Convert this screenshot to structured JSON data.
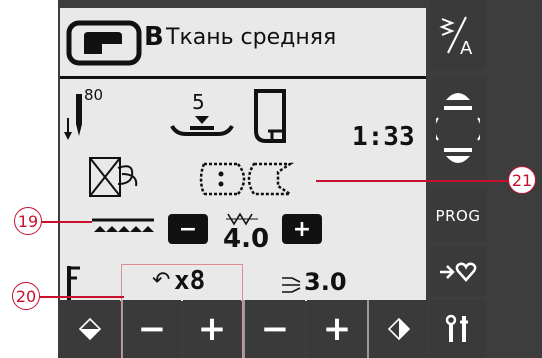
{
  "header": {
    "fabric_label": "Ткань средняя",
    "stitch_group": "B"
  },
  "needle": {
    "size": "80"
  },
  "presser_foot": {
    "pressure": "5"
  },
  "stitch": {
    "number": "1:33"
  },
  "width": {
    "value": "4.0",
    "minus_label": "−",
    "plus_label": "+"
  },
  "repeat": {
    "prefix": "↶",
    "value": "x8"
  },
  "length": {
    "value": "3.0"
  },
  "right_buttons": {
    "alpha_label": "A",
    "prog_label": "PROG"
  },
  "callouts": {
    "c19": "19",
    "c20": "20",
    "c21": "21"
  },
  "bottom": {
    "minus1": "−",
    "plus1": "+",
    "minus2": "−",
    "plus2": "+"
  }
}
